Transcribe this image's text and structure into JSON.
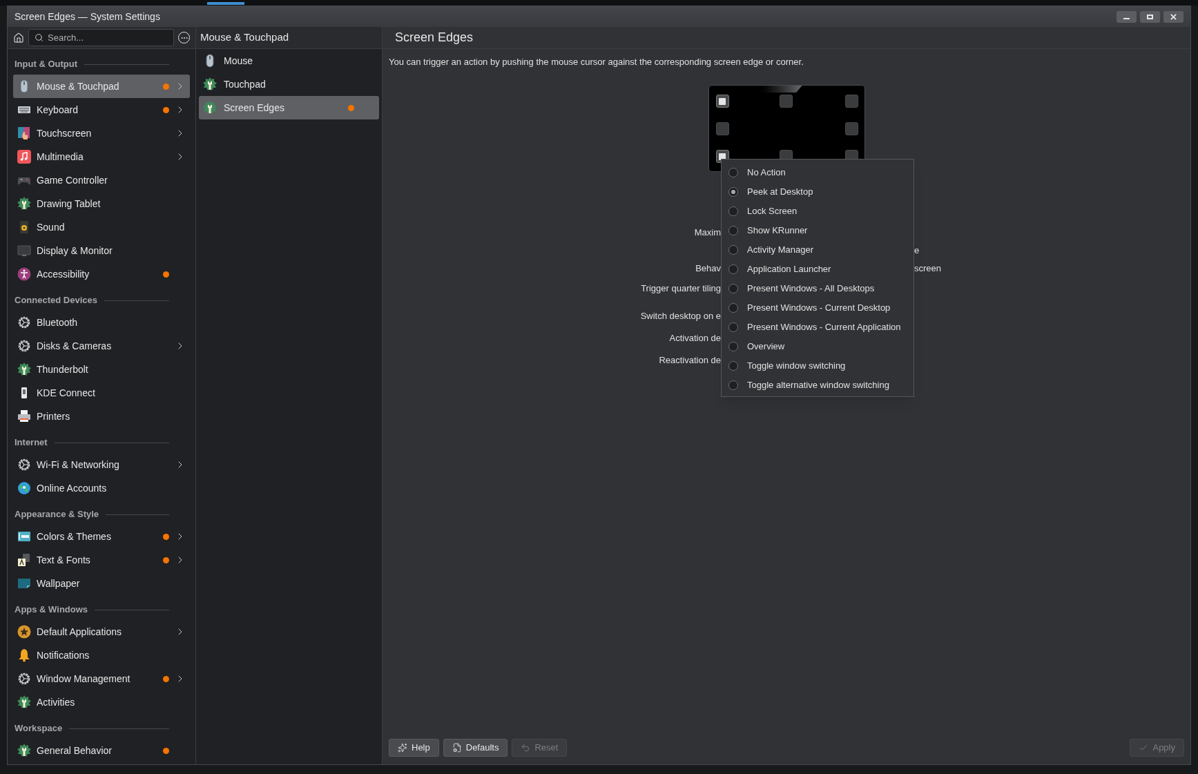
{
  "window": {
    "title": "Screen Edges — System Settings"
  },
  "sidebar": {
    "search": {
      "placeholder": "Search..."
    },
    "sections": [
      {
        "heading": "Input & Output",
        "items": [
          {
            "label": "Mouse & Touchpad",
            "kind": "mouse",
            "selected": true,
            "modified": true,
            "expandable": true
          },
          {
            "label": "Keyboard",
            "kind": "keyboard",
            "selected": false,
            "modified": true,
            "expandable": true
          },
          {
            "label": "Touchscreen",
            "kind": "touchscreen",
            "selected": false,
            "modified": false,
            "expandable": true
          },
          {
            "label": "Multimedia",
            "kind": "music",
            "selected": false,
            "modified": false,
            "expandable": true
          },
          {
            "label": "Game Controller",
            "kind": "gamepad",
            "selected": false,
            "modified": false,
            "expandable": false
          },
          {
            "label": "Drawing Tablet",
            "kind": "wrench",
            "selected": false,
            "modified": false,
            "expandable": false
          },
          {
            "label": "Sound",
            "kind": "speaker",
            "selected": false,
            "modified": false,
            "expandable": false
          },
          {
            "label": "Display & Monitor",
            "kind": "monitor",
            "selected": false,
            "modified": false,
            "expandable": false
          },
          {
            "label": "Accessibility",
            "kind": "accessibility",
            "selected": false,
            "modified": true,
            "expandable": false
          }
        ]
      },
      {
        "heading": "Connected Devices",
        "items": [
          {
            "label": "Bluetooth",
            "kind": "gear",
            "selected": false,
            "modified": false,
            "expandable": false
          },
          {
            "label": "Disks & Cameras",
            "kind": "gear",
            "selected": false,
            "modified": false,
            "expandable": true
          },
          {
            "label": "Thunderbolt",
            "kind": "wrench",
            "selected": false,
            "modified": false,
            "expandable": false
          },
          {
            "label": "KDE Connect",
            "kind": "phone",
            "selected": false,
            "modified": false,
            "expandable": false
          },
          {
            "label": "Printers",
            "kind": "printer",
            "selected": false,
            "modified": false,
            "expandable": false
          }
        ]
      },
      {
        "heading": "Internet",
        "items": [
          {
            "label": "Wi-Fi & Networking",
            "kind": "gear",
            "selected": false,
            "modified": false,
            "expandable": true
          },
          {
            "label": "Online Accounts",
            "kind": "globe",
            "selected": false,
            "modified": false,
            "expandable": false
          }
        ]
      },
      {
        "heading": "Appearance & Style",
        "items": [
          {
            "label": "Colors & Themes",
            "kind": "window",
            "selected": false,
            "modified": true,
            "expandable": true
          },
          {
            "label": "Text & Fonts",
            "kind": "font",
            "selected": false,
            "modified": true,
            "expandable": true
          },
          {
            "label": "Wallpaper",
            "kind": "wallpaper",
            "selected": false,
            "modified": false,
            "expandable": false
          }
        ]
      },
      {
        "heading": "Apps & Windows",
        "items": [
          {
            "label": "Default Applications",
            "kind": "star",
            "selected": false,
            "modified": false,
            "expandable": true
          },
          {
            "label": "Notifications",
            "kind": "bell",
            "selected": false,
            "modified": false,
            "expandable": false
          },
          {
            "label": "Window Management",
            "kind": "gear",
            "selected": false,
            "modified": true,
            "expandable": true
          },
          {
            "label": "Activities",
            "kind": "wrench",
            "selected": false,
            "modified": false,
            "expandable": false
          }
        ]
      },
      {
        "heading": "Workspace",
        "items": [
          {
            "label": "General Behavior",
            "kind": "wrench",
            "selected": false,
            "modified": true,
            "expandable": false
          }
        ]
      }
    ]
  },
  "subpanel": {
    "title": "Mouse & Touchpad",
    "items": [
      {
        "label": "Mouse",
        "kind": "mouse",
        "selected": false,
        "modified": false
      },
      {
        "label": "Touchpad",
        "kind": "wrench",
        "selected": false,
        "modified": false
      },
      {
        "label": "Screen Edges",
        "kind": "wrench",
        "selected": true,
        "modified": true
      }
    ]
  },
  "page": {
    "title": "Screen Edges",
    "description": "You can trigger an action by pushing the mouse cursor against the corresponding screen edge or corner.",
    "edges": [
      {
        "active": true
      },
      {
        "active": false
      },
      {
        "active": false
      },
      {
        "active": false
      },
      {
        "active": false
      },
      {
        "active": true
      },
      {
        "active": false
      },
      {
        "active": false
      }
    ],
    "form_rows": [
      {
        "label": "Maxim"
      },
      {
        "value": "e"
      },
      {
        "label": "Behav",
        "value": "screen"
      },
      {
        "label": "Trigger quarter tiling"
      },
      {
        "label": "Switch desktop on e"
      },
      {
        "label": "Activation de"
      },
      {
        "label": "Reactivation de"
      }
    ],
    "menu": [
      {
        "label": "No Action",
        "selected": false
      },
      {
        "label": "Peek at Desktop",
        "selected": true
      },
      {
        "label": "Lock Screen",
        "selected": false
      },
      {
        "label": "Show KRunner",
        "selected": false
      },
      {
        "label": "Activity Manager",
        "selected": false
      },
      {
        "label": "Application Launcher",
        "selected": false
      },
      {
        "label": "Present Windows - All Desktops",
        "selected": false
      },
      {
        "label": "Present Windows - Current Desktop",
        "selected": false
      },
      {
        "label": "Present Windows - Current Application",
        "selected": false
      },
      {
        "label": "Overview",
        "selected": false
      },
      {
        "label": "Toggle window switching",
        "selected": false
      },
      {
        "label": "Toggle alternative window switching",
        "selected": false
      }
    ]
  },
  "footer": {
    "left": [
      {
        "label": "Help",
        "kind": "help",
        "disabled": false
      },
      {
        "label": "Defaults",
        "kind": "defaults",
        "disabled": false
      },
      {
        "label": "Reset",
        "kind": "reset",
        "disabled": true
      }
    ],
    "right": [
      {
        "label": "Apply",
        "kind": "apply",
        "disabled": true
      }
    ]
  }
}
